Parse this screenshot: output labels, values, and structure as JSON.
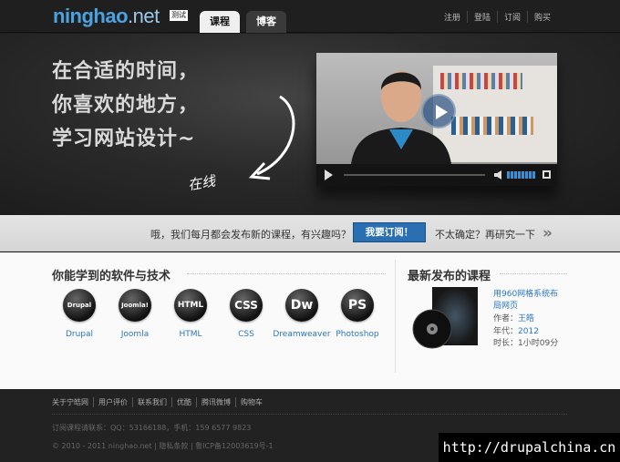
{
  "header": {
    "logo_main": "ninghao",
    "logo_dim": ".net",
    "beta_badge": "测试",
    "tabs": [
      {
        "label": "课程",
        "active": true
      },
      {
        "label": "博客",
        "active": false
      }
    ],
    "links": [
      "注册",
      "登陆",
      "订阅",
      "购买"
    ]
  },
  "hero": {
    "slogan_lines": [
      "在合适的时间，",
      "你喜欢的地方，",
      "学习网站设计~"
    ],
    "handwriting": "在线"
  },
  "subscribe_strip": {
    "question": "哦，我们每月都会发布新的课程，有兴趣吗？",
    "button_label": "我要订阅！",
    "more_text": "不太确定？再研究一下",
    "arrow": "»"
  },
  "skills": {
    "title": "你能学到的软件与技术",
    "items": [
      {
        "name": "Drupal",
        "icon_text": "Drupal",
        "icon": "drupal-logo-icon"
      },
      {
        "name": "Joomla",
        "icon_text": "Joomla!",
        "icon": "joomla-logo-icon"
      },
      {
        "name": "HTML",
        "icon_text": "HTML",
        "icon": "html-logo-icon"
      },
      {
        "name": "CSS",
        "icon_text": "CSS",
        "icon": "css-logo-icon"
      },
      {
        "name": "Dreamweaver",
        "icon_text": "Dw",
        "icon": "dreamweaver-logo-icon"
      },
      {
        "name": "Photoshop",
        "icon_text": "PS",
        "icon": "photoshop-logo-icon"
      }
    ]
  },
  "latest_course": {
    "title": "最新发布的课程",
    "course_title": "用960网格系统布局网页",
    "author_label": "作者：",
    "author": "王皓",
    "year_label": "年代：",
    "year": "2012",
    "duration_label": "时长：",
    "duration": "1小时09分"
  },
  "footer": {
    "links": [
      "关于宁皓网",
      "用户评价",
      "联系我们",
      "优酷",
      "腾讯微博",
      "购物车"
    ],
    "contact": "订阅课程请联系：QQ：53166188，手机：159 6577 9823",
    "copyright": "© 2010 - 2011 ninghao.net | 隐私条款 | 鲁ICP备12003619号-1"
  },
  "watermark": "http://drupalchina.cn",
  "colors": {
    "accent_blue": "#2a77c2",
    "button_blue": "#2a6fb1",
    "logo_blue": "#4aa3e0"
  }
}
